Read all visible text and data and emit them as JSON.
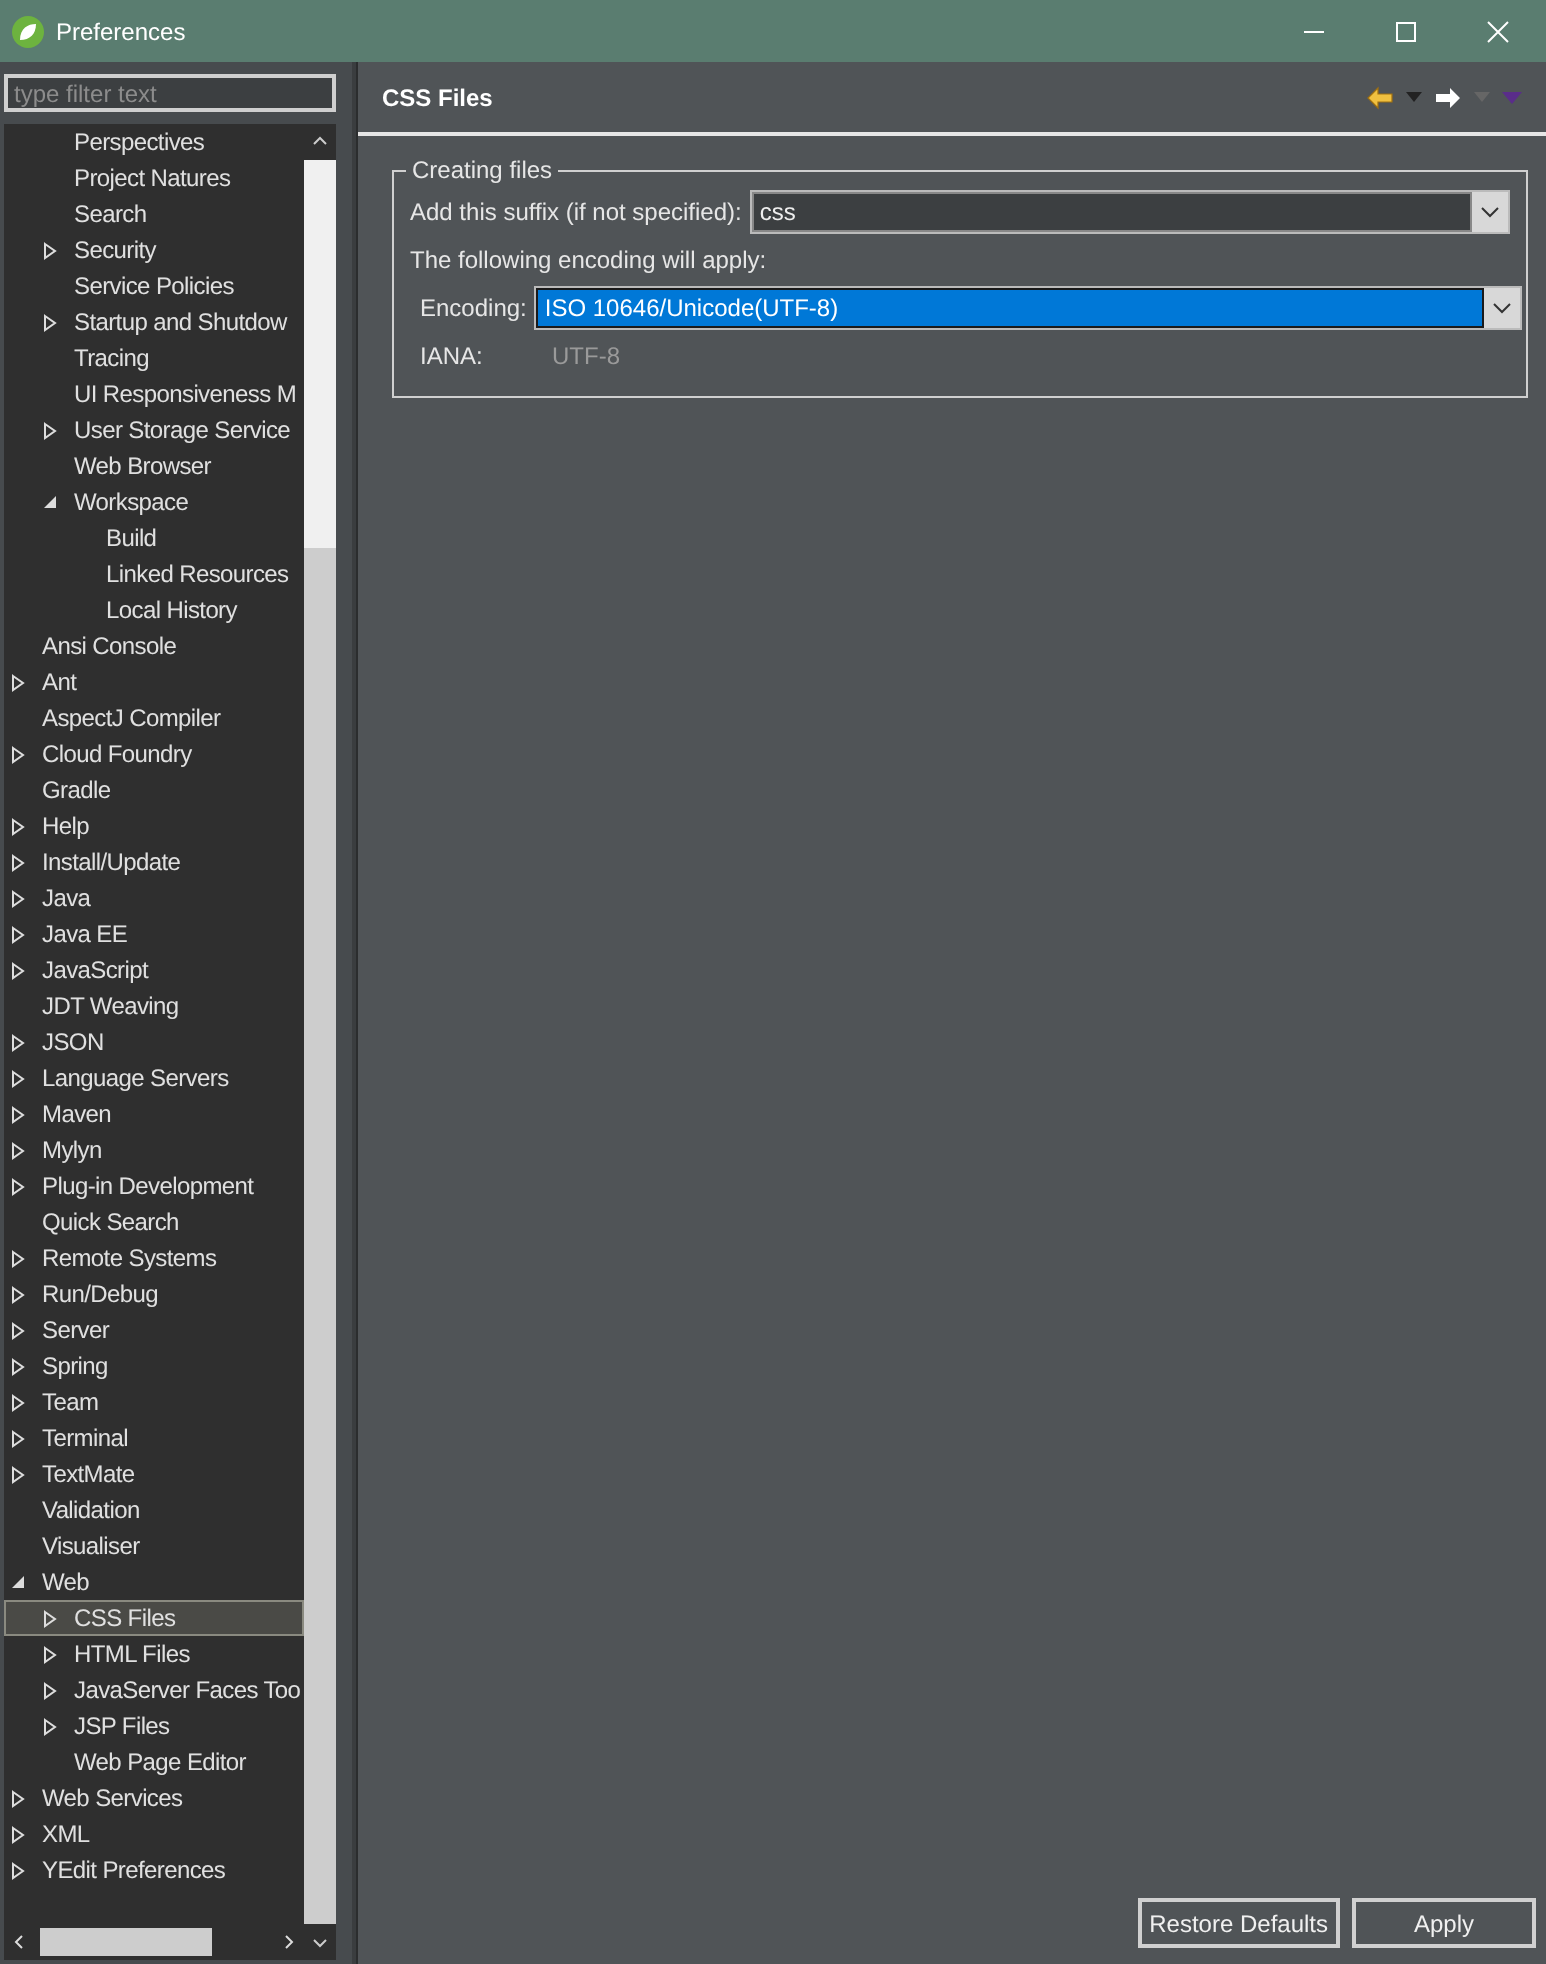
{
  "window": {
    "title": "Preferences"
  },
  "filter": {
    "placeholder": "type filter text"
  },
  "tree": {
    "scrolled_branch": [
      {
        "label": "Perspectives",
        "kind": "leaf",
        "selected": false
      },
      {
        "label": "Project Natures",
        "kind": "leaf",
        "selected": false
      },
      {
        "label": "Search",
        "kind": "leaf",
        "selected": false
      },
      {
        "label": "Security",
        "kind": "branch",
        "expanded": false,
        "selected": false
      },
      {
        "label": "Service Policies",
        "kind": "leaf",
        "selected": false
      },
      {
        "label": "Startup and Shutdow",
        "kind": "branch",
        "expanded": false,
        "selected": false
      },
      {
        "label": "Tracing",
        "kind": "leaf",
        "selected": false
      },
      {
        "label": "UI Responsiveness M",
        "kind": "leaf",
        "selected": false
      },
      {
        "label": "User Storage Service",
        "kind": "branch",
        "expanded": false,
        "selected": false
      },
      {
        "label": "Web Browser",
        "kind": "leaf",
        "selected": false
      },
      {
        "label": "Workspace",
        "kind": "branch",
        "expanded": true,
        "selected": false,
        "children": [
          {
            "label": "Build",
            "kind": "leaf",
            "selected": false
          },
          {
            "label": "Linked Resources",
            "kind": "leaf",
            "selected": false
          },
          {
            "label": "Local History",
            "kind": "leaf",
            "selected": false
          }
        ]
      }
    ],
    "items": [
      {
        "label": "Ansi Console",
        "kind": "leaf",
        "selected": false
      },
      {
        "label": "Ant",
        "kind": "branch",
        "expanded": false,
        "selected": false
      },
      {
        "label": "AspectJ Compiler",
        "kind": "leaf",
        "selected": false
      },
      {
        "label": "Cloud Foundry",
        "kind": "branch",
        "expanded": false,
        "selected": false
      },
      {
        "label": "Gradle",
        "kind": "leaf",
        "selected": false
      },
      {
        "label": "Help",
        "kind": "branch",
        "expanded": false,
        "selected": false
      },
      {
        "label": "Install/Update",
        "kind": "branch",
        "expanded": false,
        "selected": false
      },
      {
        "label": "Java",
        "kind": "branch",
        "expanded": false,
        "selected": false
      },
      {
        "label": "Java EE",
        "kind": "branch",
        "expanded": false,
        "selected": false
      },
      {
        "label": "JavaScript",
        "kind": "branch",
        "expanded": false,
        "selected": false
      },
      {
        "label": "JDT Weaving",
        "kind": "leaf",
        "selected": false
      },
      {
        "label": "JSON",
        "kind": "branch",
        "expanded": false,
        "selected": false
      },
      {
        "label": "Language Servers",
        "kind": "branch",
        "expanded": false,
        "selected": false
      },
      {
        "label": "Maven",
        "kind": "branch",
        "expanded": false,
        "selected": false
      },
      {
        "label": "Mylyn",
        "kind": "branch",
        "expanded": false,
        "selected": false
      },
      {
        "label": "Plug-in Development",
        "kind": "branch",
        "expanded": false,
        "selected": false
      },
      {
        "label": "Quick Search",
        "kind": "leaf",
        "selected": false
      },
      {
        "label": "Remote Systems",
        "kind": "branch",
        "expanded": false,
        "selected": false
      },
      {
        "label": "Run/Debug",
        "kind": "branch",
        "expanded": false,
        "selected": false
      },
      {
        "label": "Server",
        "kind": "branch",
        "expanded": false,
        "selected": false
      },
      {
        "label": "Spring",
        "kind": "branch",
        "expanded": false,
        "selected": false
      },
      {
        "label": "Team",
        "kind": "branch",
        "expanded": false,
        "selected": false
      },
      {
        "label": "Terminal",
        "kind": "branch",
        "expanded": false,
        "selected": false
      },
      {
        "label": "TextMate",
        "kind": "branch",
        "expanded": false,
        "selected": false
      },
      {
        "label": "Validation",
        "kind": "leaf",
        "selected": false
      },
      {
        "label": "Visualiser",
        "kind": "leaf",
        "selected": false
      },
      {
        "label": "Web",
        "kind": "branch",
        "expanded": true,
        "selected": false,
        "children": [
          {
            "label": "CSS Files",
            "kind": "branch",
            "expanded": false,
            "selected": true
          },
          {
            "label": "HTML Files",
            "kind": "branch",
            "expanded": false,
            "selected": false
          },
          {
            "label": "JavaServer Faces Too",
            "kind": "branch",
            "expanded": false,
            "selected": false
          },
          {
            "label": "JSP Files",
            "kind": "branch",
            "expanded": false,
            "selected": false
          },
          {
            "label": "Web Page Editor",
            "kind": "leaf",
            "selected": false
          }
        ]
      },
      {
        "label": "Web Services",
        "kind": "branch",
        "expanded": false,
        "selected": false
      },
      {
        "label": "XML",
        "kind": "branch",
        "expanded": false,
        "selected": false
      },
      {
        "label": "YEdit Preferences",
        "kind": "branch",
        "expanded": false,
        "selected": false
      }
    ]
  },
  "page": {
    "title": "CSS Files",
    "group": {
      "title": "Creating files",
      "suffix": {
        "label": "Add this suffix (if not specified):",
        "value": "css"
      },
      "note": "The following encoding will apply:",
      "encoding": {
        "label": "Encoding:",
        "value": "ISO 10646/Unicode(UTF-8)"
      },
      "iana": {
        "label": "IANA:",
        "value": "UTF-8"
      }
    }
  },
  "buttons": [
    "Restore Defaults",
    "Apply"
  ]
}
